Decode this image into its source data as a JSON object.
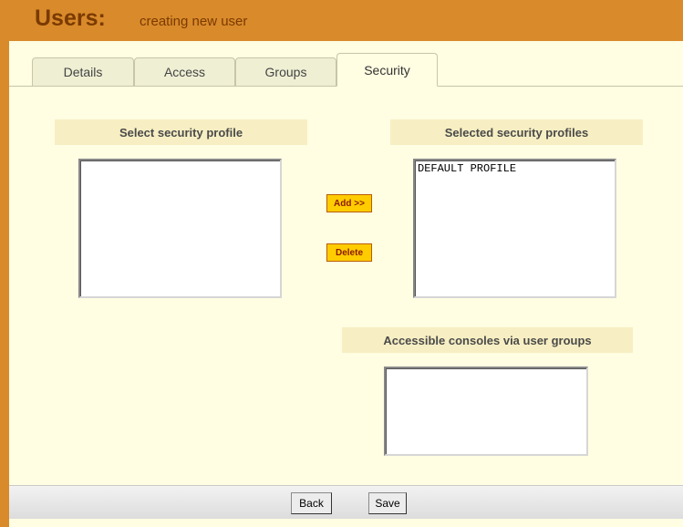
{
  "header": {
    "title": "Users:",
    "subtitle": "creating new user"
  },
  "tabs": [
    {
      "label": "Details",
      "active": false
    },
    {
      "label": "Access",
      "active": false
    },
    {
      "label": "Groups",
      "active": false
    },
    {
      "label": "Security",
      "active": true
    }
  ],
  "security": {
    "available_label": "Select security profile",
    "available_items": [],
    "selected_label": "Selected security profiles",
    "selected_items": [
      "DEFAULT PROFILE"
    ],
    "add_button": "Add >>",
    "delete_button": "Delete",
    "consoles_label": "Accessible consoles via user groups",
    "consoles_items": []
  },
  "footer": {
    "back_button": "Back",
    "save_button": "Save"
  },
  "colors": {
    "frame": "#d98a2b",
    "content_bg": "#fffde2",
    "label_bg": "#f7efc3",
    "action_button": "#ffcc00"
  }
}
